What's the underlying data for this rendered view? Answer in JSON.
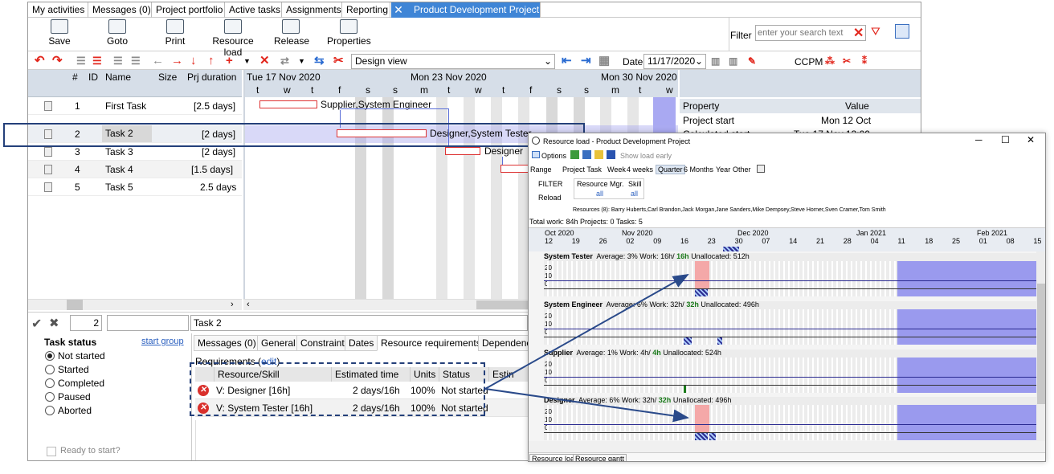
{
  "tabs": [
    "My activities",
    "Messages (0)",
    "Project portfolio",
    "Active tasks",
    "Assignments",
    "Reporting"
  ],
  "active_tab": "Product Development Project",
  "close_glyph": "✕",
  "ribbon": {
    "save": "Save",
    "goto": "Goto",
    "print": "Print",
    "resource_load": "Resource load",
    "release": "Release",
    "properties": "Properties"
  },
  "filter": {
    "label": "Filter",
    "placeholder": "enter your search text"
  },
  "toolbar": {
    "view": "Design view",
    "date_label": "Date",
    "date": "11/17/2020",
    "ccpm": "CCPM"
  },
  "grid": {
    "headers": {
      "num": "#",
      "id": "ID",
      "name": "Name",
      "size": "Size",
      "duration": "Prj duration"
    },
    "rows": [
      {
        "num": "1",
        "name": "First Task",
        "duration": "[2.5 days]"
      },
      {
        "num": "2",
        "name": "Task 2",
        "duration": "[2 days]"
      },
      {
        "num": "3",
        "name": "Task 3",
        "duration": "[2 days]"
      },
      {
        "num": "4",
        "name": "Task 4",
        "duration": "[1.5 days]"
      },
      {
        "num": "5",
        "name": "Task 5",
        "duration": "2.5 days"
      }
    ]
  },
  "gantt": {
    "weeks": [
      "Tue 17 Nov 2020",
      "Mon 23 Nov 2020",
      "Mon 30 Nov 2020"
    ],
    "days": [
      "t",
      "w",
      "t",
      "f",
      "s",
      "s",
      "m",
      "t",
      "w",
      "t",
      "f",
      "s",
      "s",
      "m",
      "t",
      "w"
    ],
    "labels": [
      "Supplier,System Engineer",
      "Designer,System Tester",
      "Designer"
    ]
  },
  "properties": {
    "header": "Property",
    "value_header": "Value",
    "rows": [
      {
        "k": "Project start",
        "v": "Mon 12 Oct"
      },
      {
        "k": "Calculated start",
        "v": "Tue 17 Nov 13:00"
      }
    ]
  },
  "bottom": {
    "id_value": "2",
    "task_name": "Task 2",
    "status_title": "Task status",
    "start_group": "start group",
    "statuses": [
      "Not started",
      "Started",
      "Completed",
      "Paused",
      "Aborted"
    ],
    "ready": "Ready to start?",
    "subtabs": [
      "Messages (0)",
      "General",
      "Constraint",
      "Dates",
      "Resource requirements",
      "Dependenc"
    ],
    "requirements_label": "Requirements",
    "edit": "edit",
    "req_headers": [
      "Resource/Skill",
      "Estimated time",
      "Units",
      "Status",
      "Estin"
    ],
    "req_rows": [
      {
        "res": "V: Designer [16h]",
        "time": "2 days/16h",
        "units": "100%",
        "status": "Not started"
      },
      {
        "res": "V: System Tester [16h]",
        "time": "2 days/16h",
        "units": "100%",
        "status": "Not started"
      }
    ]
  },
  "resource_load": {
    "title": "Resource load - Product Development Project",
    "options": "Options",
    "show_load_early": "Show load early",
    "range_label": "Range",
    "project_task": "Project Task",
    "ranges": [
      "Week",
      "4 weeks",
      "Quarter",
      "6 Months",
      "Year",
      "Other"
    ],
    "filter": "FILTER",
    "reload": "Reload",
    "resource_mgr": "Resource Mgr.",
    "skill": "Skill",
    "all": "all",
    "resources": "Resources (8): Barry Huberts,Carl Brandon,Jack Morgan,Jane Sanders,Mike Dempsey,Steve Horner,Sven Cramer,Tom Smith",
    "total": "Total work: 84h  Projects: 0  Tasks: 5",
    "months": [
      "Oct 2020",
      "Nov 2020",
      "Dec 2020",
      "Jan 2021",
      "Feb 2021"
    ],
    "dates": [
      "12",
      "19",
      "26",
      "02",
      "09",
      "16",
      "23",
      "30",
      "07",
      "14",
      "21",
      "28",
      "04",
      "11",
      "18",
      "25",
      "01",
      "08",
      "15"
    ],
    "ticks": [
      "20",
      "10",
      "0"
    ],
    "sections": [
      {
        "name": "System Tester",
        "avg": "Average: 3%",
        "work": "Work: 16h/",
        "bold": "16h",
        "un": "Unallocated: 512h"
      },
      {
        "name": "System Engineer",
        "avg": "Average: 6%",
        "work": "Work: 32h/",
        "bold": "32h",
        "un": "Unallocated: 496h"
      },
      {
        "name": "Supplier",
        "avg": "Average: 1%",
        "work": "Work: 4h/",
        "bold": "4h",
        "un": "Unallocated: 524h"
      },
      {
        "name": "Designer",
        "avg": "Average: 6%",
        "work": "Work: 32h/",
        "bold": "32h",
        "un": "Unallocated: 496h"
      }
    ],
    "bottom_tabs": [
      "Resource load",
      "Resource gantt"
    ]
  }
}
